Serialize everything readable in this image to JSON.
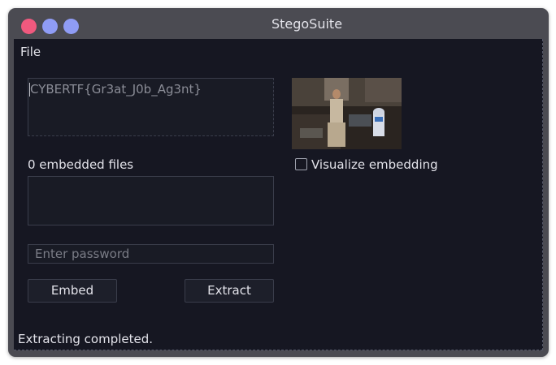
{
  "window": {
    "title": "StegoSuite"
  },
  "menu": {
    "items": [
      "File"
    ]
  },
  "message": {
    "value": "CYBERTF{Gr3at_J0b_Ag3nt}"
  },
  "embedded_files": {
    "label": "0 embedded files"
  },
  "password": {
    "placeholder": "Enter password",
    "value": ""
  },
  "buttons": {
    "embed_label": "Embed",
    "extract_label": "Extract"
  },
  "visualize": {
    "label": "Visualize embedding",
    "checked": false
  },
  "status": {
    "text": "Extracting completed."
  },
  "colors": {
    "close": "#f0597e",
    "minimize": "#8f9cf5",
    "maximize": "#8f9cf5",
    "background": "#161722"
  }
}
